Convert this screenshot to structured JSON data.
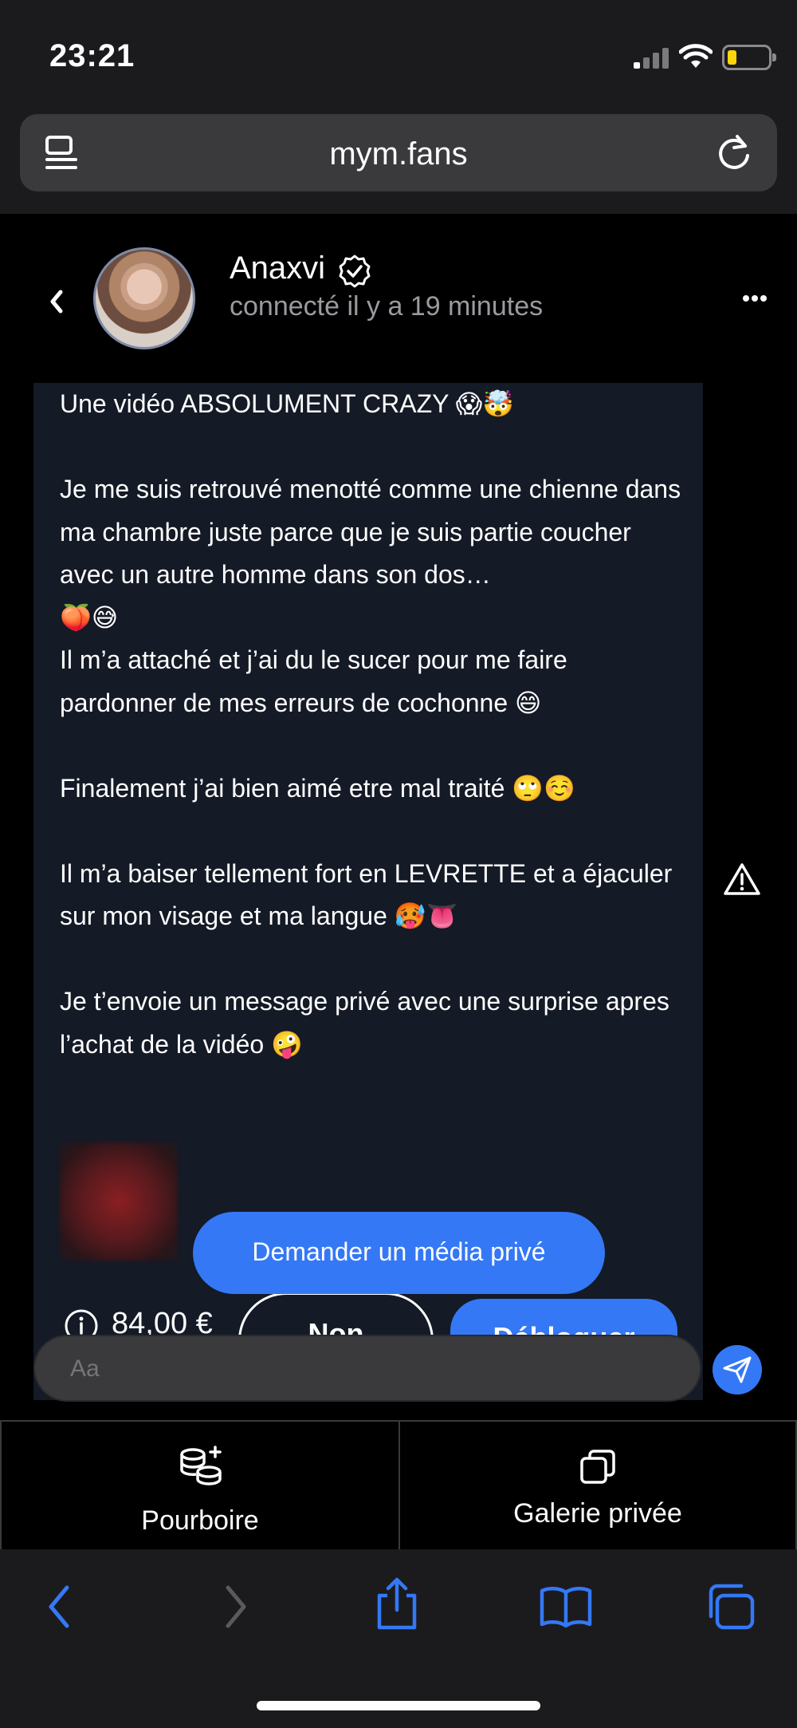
{
  "status_bar": {
    "time": "23:21"
  },
  "browser": {
    "url": "mym.fans"
  },
  "chat_header": {
    "name": "Anaxvi",
    "presence": "connecté il y a 19 minutes"
  },
  "message": {
    "text": "Une vidéo ABSOLUMENT CRAZY 😱🤯\n\nJe me suis retrouvé menotté comme une chienne dans ma chambre juste parce que je suis partie coucher avec un autre homme dans son dos…\n🍑😅\nIl m’a attaché et j’ai du le sucer pour me faire pardonner de mes erreurs de cochonne 😄\n\nFinalement j’ai bien aimé etre mal traité 🙄☺️\n\nIl m’a baiser tellement fort en LEVRETTE et a éjaculer sur mon visage et ma langue 🥵👅\n\nJe t’envoie un message privé avec une surprise apres l’achat de la vidéo 🤪",
    "price": "84,00 €",
    "decline_label": "Non",
    "unlock_label": "Débloquer"
  },
  "request_media_label": "Demander un média privé",
  "composer": {
    "placeholder": "Aa"
  },
  "actions": {
    "tip_label": "Pourboire",
    "gallery_label": "Galerie privée"
  },
  "colors": {
    "accent": "#3478f6",
    "bubble": "#141a26",
    "chrome": "#1b1b1d",
    "battery": "#ffd60a"
  }
}
